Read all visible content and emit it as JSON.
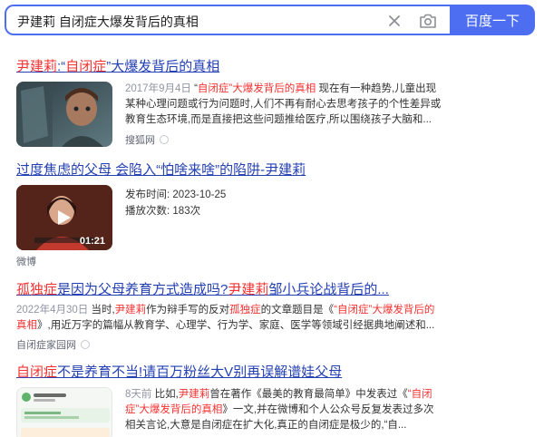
{
  "search": {
    "query": "尹建莉 自闭症大爆发背后的真相",
    "button_label": "百度一下"
  },
  "results": [
    {
      "title_hl": "尹建莉",
      "title_sep": ":“",
      "title_hl2": "自闭症",
      "title_rest": "”大爆发背后的真相",
      "date": "2017年9月4日",
      "snippet_q1": " “",
      "snippet_hl": "自闭症",
      "snippet_hl2": "”大爆发背后的真相",
      "snippet_rest": " 现在有一种趋势,儿童出现某种心理问题或行为问题时,人们不再有耐心去思考孩子的个性差异或教育生态环境,而是直接把这些问题推给医疗,所以围绕孩子大脑和...",
      "source": "搜狐网"
    },
    {
      "title": "过度焦虑的父母 会陷入“怕啥来啥”的陷阱-尹建莉",
      "publish_label": "发布时间:",
      "publish_date": "2023-10-25",
      "plays_label": "播放次数:",
      "plays": "183次",
      "duration": "01:21",
      "source": "微博"
    },
    {
      "title_hl": "孤独症",
      "title_mid": "是因为父母养育方式造成吗?",
      "title_hl2": "尹建莉",
      "title_rest": "邹小兵论战背后的...",
      "date": "2022年4月30日",
      "snippet_a": " 当时,",
      "snippet_hl": "尹建莉",
      "snippet_b": "作为辩手写的反对",
      "snippet_hl2": "孤独症",
      "snippet_c": "的文章题目是《",
      "snippet_hl3": "“自闭症”大爆发背后的真相",
      "snippet_d": "》,用近万字的篇幅从教育学、心理学、行为学、家庭、医学等领域引经据典地阐述和...",
      "source": "自闭症家园网"
    },
    {
      "title_hl": "自闭症",
      "title_mid": "不是养育不当!请百万粉丝大V别再误解谱娃父母",
      "date": "8天前",
      "snippet_a": " 比如,",
      "snippet_hl": "尹建莉",
      "snippet_b": "曾在著作《最美的教育最简单》中发表过《",
      "snippet_hl2": "“自闭症”大爆发背后的真相",
      "snippet_c": "》一文,并在微博和个人公众号反复发表过多次相关言论,大意是自闭症在扩大化,真正的自闭症是极少的,“自..."
    }
  ]
}
